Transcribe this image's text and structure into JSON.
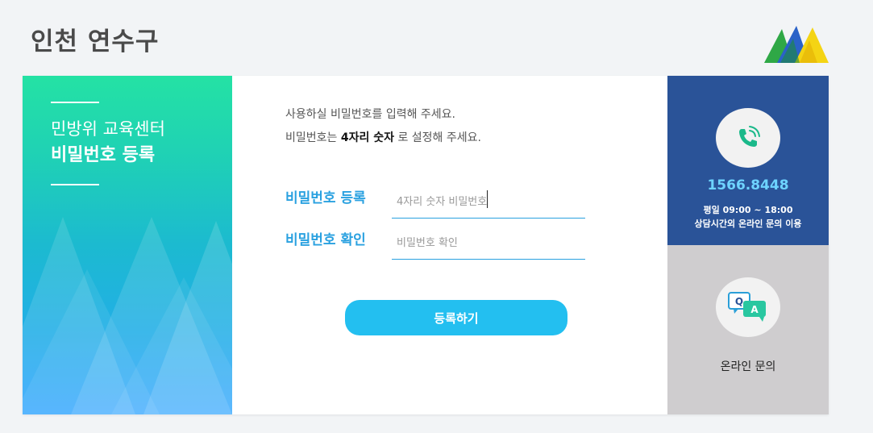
{
  "header": {
    "title": "인천 연수구",
    "logo_icon": "mountain-logo-icon"
  },
  "left": {
    "subtitle": "민방위 교육센터",
    "title": "비밀번호 등록"
  },
  "form": {
    "guide_line1": "사용하실 비밀번호를 입력해 주세요.",
    "guide_line2_prefix": "비밀번호는 ",
    "guide_line2_strong": "4자리 숫자",
    "guide_line2_suffix": " 로 설정해 주세요.",
    "password_label": "비밀번호 등록",
    "password_placeholder": "4자리 숫자 비밀번호",
    "password_value": "",
    "confirm_label": "비밀번호 확인",
    "confirm_placeholder": "비밀번호 확인",
    "confirm_value": "",
    "submit_label": "등록하기"
  },
  "contact": {
    "phone_icon": "phone-icon",
    "phone": "1566.8448",
    "hours_line1": "평일 09:00 ~ 18:00",
    "hours_line2": "상담시간외 온라인 문의 이용",
    "qa_icon": "qa-chat-icon",
    "online_label": "온라인 문의"
  },
  "colors": {
    "accent": "#2aa1e0",
    "button": "#23bff0",
    "contact_bg": "#2a5398",
    "online_bg": "#cfcdcf",
    "phone_text": "#6ed3ff"
  }
}
